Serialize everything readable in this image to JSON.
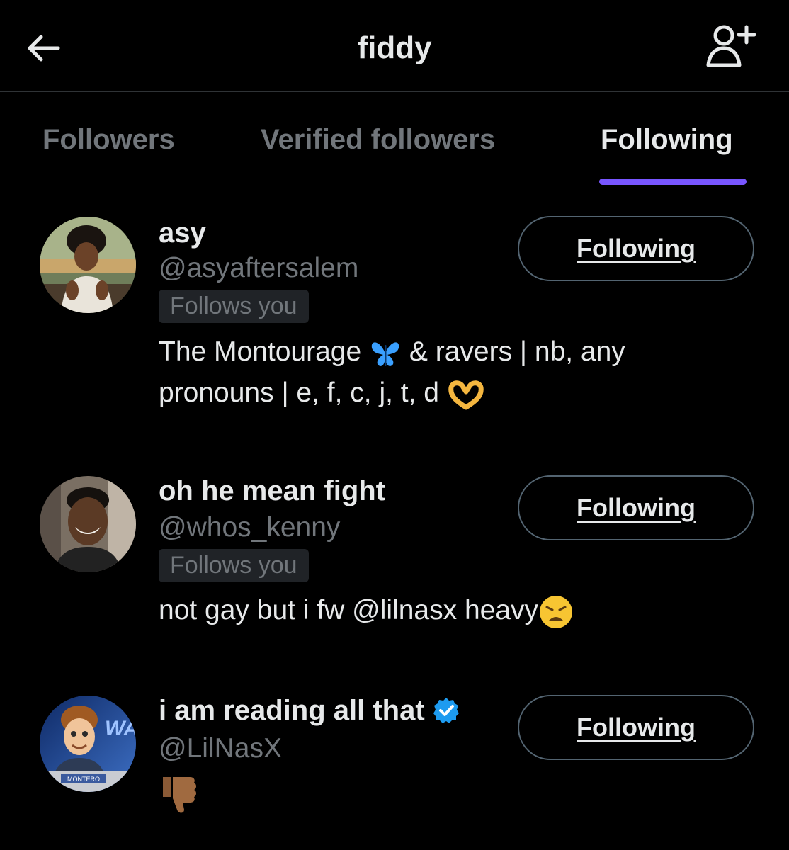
{
  "header": {
    "title": "fiddy",
    "back_icon": "arrow-left-icon",
    "add_user_icon": "person-plus-icon"
  },
  "tabs": [
    {
      "label": "Followers",
      "active": false
    },
    {
      "label": "Verified followers",
      "active": false
    },
    {
      "label": "Following",
      "active": true
    }
  ],
  "colors": {
    "background": "#000000",
    "text_primary": "#e7e9ea",
    "text_secondary": "#71767b",
    "accent": "#7856ff",
    "verified": "#1d9bf0"
  },
  "users": [
    {
      "display_name": "asy",
      "handle": "@asyaftersalem",
      "follows_you": "Follows you",
      "bio_line1": "The Montourage",
      "bio_line1_rest": "& ravers | nb, any",
      "bio_line2": "pronouns | e, f, c, j, t, d",
      "button_label": "Following",
      "verified": false
    },
    {
      "display_name": "oh he mean fight",
      "handle": "@whos_kenny",
      "follows_you": "Follows you",
      "bio_line1": "not gay but i fw @lilnasx heavy",
      "button_label": "Following",
      "verified": false
    },
    {
      "display_name": "i am reading all that",
      "handle": "@LilNasX",
      "button_label": "Following",
      "verified": true,
      "avatar_caption": "MONTERO"
    }
  ]
}
